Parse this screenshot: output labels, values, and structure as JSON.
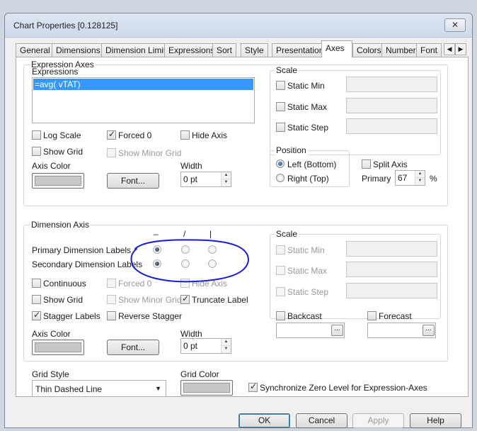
{
  "window": {
    "title": "Chart Properties [0.128125]",
    "close_label": "✕"
  },
  "tabs": [
    "General",
    "Dimensions",
    "Dimension Limits",
    "Expressions",
    "Sort",
    "Style",
    "Presentation",
    "Axes",
    "Colors",
    "Number",
    "Font"
  ],
  "active_tab": "Axes",
  "expression_axes": {
    "legend": "Expression Axes",
    "expressions_label": "Expressions",
    "expressions": [
      "=avg( vTAT)"
    ],
    "log_scale": {
      "label": "Log Scale",
      "checked": false
    },
    "forced0": {
      "label": "Forced 0",
      "checked": true
    },
    "hide_axis": {
      "label": "Hide Axis",
      "checked": false
    },
    "show_grid": {
      "label": "Show Grid",
      "checked": false
    },
    "show_minor_grid": {
      "label": "Show Minor Grid",
      "checked": false
    },
    "axis_color_label": "Axis Color",
    "font_button": "Font...",
    "width_label": "Width",
    "width_value": "0 pt",
    "scale": {
      "legend": "Scale",
      "static_min": "Static Min",
      "static_max": "Static Max",
      "static_step": "Static Step"
    },
    "position": {
      "legend": "Position",
      "left_bottom": "Left (Bottom)",
      "right_top": "Right (Top)",
      "selected": "left_bottom"
    },
    "split_axis": {
      "label": "Split Axis",
      "checked": false
    },
    "primary_label": "Primary",
    "primary_value": "67",
    "primary_unit": "%"
  },
  "dimension_axis": {
    "legend": "Dimension Axis",
    "orientation_headers": [
      "_",
      "/",
      "|"
    ],
    "primary_labels": "Primary Dimension Labels",
    "secondary_labels": "Secondary Dimension Labels",
    "primary_selected": 0,
    "secondary_selected": 0,
    "continuous": {
      "label": "Continuous",
      "checked": false
    },
    "forced0": {
      "label": "Forced 0",
      "checked": false
    },
    "hide_axis": {
      "label": "Hide Axis",
      "checked": false
    },
    "show_grid": {
      "label": "Show Grid",
      "checked": false
    },
    "show_minor_grid": {
      "label": "Show Minor Grid",
      "checked": false
    },
    "truncate_label": {
      "label": "Truncate Label",
      "checked": true
    },
    "stagger_labels": {
      "label": "Stagger Labels",
      "checked": true
    },
    "reverse_stagger": {
      "label": "Reverse Stagger",
      "checked": false
    },
    "axis_color_label": "Axis Color",
    "font_button": "Font...",
    "width_label": "Width",
    "width_value": "0 pt",
    "scale": {
      "legend": "Scale",
      "static_min": "Static Min",
      "static_max": "Static Max",
      "static_step": "Static Step"
    },
    "backcast": {
      "label": "Backcast",
      "checked": false
    },
    "forecast": {
      "label": "Forecast",
      "checked": false
    },
    "ellipsis": "..."
  },
  "grid_style": {
    "label": "Grid Style",
    "value": "Thin Dashed Line"
  },
  "grid_color_label": "Grid Color",
  "sync_zero": {
    "label": "Synchronize Zero Level for Expression-Axes",
    "checked": true
  },
  "buttons": {
    "ok": "OK",
    "cancel": "Cancel",
    "apply": "Apply",
    "help": "Help"
  },
  "colors": {
    "annotation": "#1a1adb",
    "selection": "#3399ff"
  }
}
